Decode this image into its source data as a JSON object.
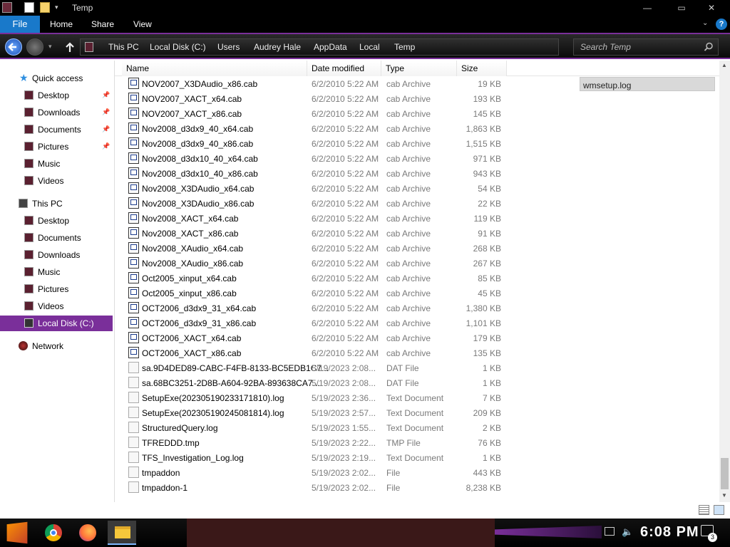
{
  "window": {
    "title": "Temp"
  },
  "title_buttons": {
    "minimize": "—",
    "maximize": "▭",
    "close": "✕"
  },
  "ribbon": {
    "file": "File",
    "tabs": [
      "Home",
      "Share",
      "View"
    ],
    "help": "?"
  },
  "nav": {
    "crumbs": [
      "This PC",
      "Local Disk (C:)",
      "Users",
      "Audrey Hale",
      "AppData",
      "Local",
      "Temp"
    ],
    "search_placeholder": "Search Temp"
  },
  "sidebar": {
    "quick_access": "Quick access",
    "qa_items": [
      "Desktop",
      "Downloads",
      "Documents",
      "Pictures",
      "Music",
      "Videos"
    ],
    "this_pc": "This PC",
    "pc_items": [
      "Desktop",
      "Documents",
      "Downloads",
      "Music",
      "Pictures",
      "Videos"
    ],
    "local_disk": "Local Disk (C:)",
    "network": "Network"
  },
  "columns": {
    "name": "Name",
    "date": "Date modified",
    "type": "Type",
    "size": "Size"
  },
  "files": [
    {
      "name": "NOV2007_X3DAudio_x86.cab",
      "date": "6/2/2010 5:22 AM",
      "type": "cab Archive",
      "size": "19 KB",
      "kind": "cab"
    },
    {
      "name": "NOV2007_XACT_x64.cab",
      "date": "6/2/2010 5:22 AM",
      "type": "cab Archive",
      "size": "193 KB",
      "kind": "cab"
    },
    {
      "name": "NOV2007_XACT_x86.cab",
      "date": "6/2/2010 5:22 AM",
      "type": "cab Archive",
      "size": "145 KB",
      "kind": "cab"
    },
    {
      "name": "Nov2008_d3dx9_40_x64.cab",
      "date": "6/2/2010 5:22 AM",
      "type": "cab Archive",
      "size": "1,863 KB",
      "kind": "cab"
    },
    {
      "name": "Nov2008_d3dx9_40_x86.cab",
      "date": "6/2/2010 5:22 AM",
      "type": "cab Archive",
      "size": "1,515 KB",
      "kind": "cab"
    },
    {
      "name": "Nov2008_d3dx10_40_x64.cab",
      "date": "6/2/2010 5:22 AM",
      "type": "cab Archive",
      "size": "971 KB",
      "kind": "cab"
    },
    {
      "name": "Nov2008_d3dx10_40_x86.cab",
      "date": "6/2/2010 5:22 AM",
      "type": "cab Archive",
      "size": "943 KB",
      "kind": "cab"
    },
    {
      "name": "Nov2008_X3DAudio_x64.cab",
      "date": "6/2/2010 5:22 AM",
      "type": "cab Archive",
      "size": "54 KB",
      "kind": "cab"
    },
    {
      "name": "Nov2008_X3DAudio_x86.cab",
      "date": "6/2/2010 5:22 AM",
      "type": "cab Archive",
      "size": "22 KB",
      "kind": "cab"
    },
    {
      "name": "Nov2008_XACT_x64.cab",
      "date": "6/2/2010 5:22 AM",
      "type": "cab Archive",
      "size": "119 KB",
      "kind": "cab"
    },
    {
      "name": "Nov2008_XACT_x86.cab",
      "date": "6/2/2010 5:22 AM",
      "type": "cab Archive",
      "size": "91 KB",
      "kind": "cab"
    },
    {
      "name": "Nov2008_XAudio_x64.cab",
      "date": "6/2/2010 5:22 AM",
      "type": "cab Archive",
      "size": "268 KB",
      "kind": "cab"
    },
    {
      "name": "Nov2008_XAudio_x86.cab",
      "date": "6/2/2010 5:22 AM",
      "type": "cab Archive",
      "size": "267 KB",
      "kind": "cab"
    },
    {
      "name": "Oct2005_xinput_x64.cab",
      "date": "6/2/2010 5:22 AM",
      "type": "cab Archive",
      "size": "85 KB",
      "kind": "cab"
    },
    {
      "name": "Oct2005_xinput_x86.cab",
      "date": "6/2/2010 5:22 AM",
      "type": "cab Archive",
      "size": "45 KB",
      "kind": "cab"
    },
    {
      "name": "OCT2006_d3dx9_31_x64.cab",
      "date": "6/2/2010 5:22 AM",
      "type": "cab Archive",
      "size": "1,380 KB",
      "kind": "cab"
    },
    {
      "name": "OCT2006_d3dx9_31_x86.cab",
      "date": "6/2/2010 5:22 AM",
      "type": "cab Archive",
      "size": "1,101 KB",
      "kind": "cab"
    },
    {
      "name": "OCT2006_XACT_x64.cab",
      "date": "6/2/2010 5:22 AM",
      "type": "cab Archive",
      "size": "179 KB",
      "kind": "cab"
    },
    {
      "name": "OCT2006_XACT_x86.cab",
      "date": "6/2/2010 5:22 AM",
      "type": "cab Archive",
      "size": "135 KB",
      "kind": "cab"
    },
    {
      "name": "sa.9D4DED89-CABC-F4FB-8133-BC5EDB1C7...",
      "date": "5/19/2023 2:08...",
      "type": "DAT File",
      "size": "1 KB",
      "kind": "doc"
    },
    {
      "name": "sa.68BC3251-2D8B-A604-92BA-893638CA7...",
      "date": "5/19/2023 2:08...",
      "type": "DAT File",
      "size": "1 KB",
      "kind": "doc"
    },
    {
      "name": "SetupExe(202305190233171810).log",
      "date": "5/19/2023 2:36...",
      "type": "Text Document",
      "size": "7 KB",
      "kind": "doc"
    },
    {
      "name": "SetupExe(202305190245081814).log",
      "date": "5/19/2023 2:57...",
      "type": "Text Document",
      "size": "209 KB",
      "kind": "doc"
    },
    {
      "name": "StructuredQuery.log",
      "date": "5/19/2023 1:55...",
      "type": "Text Document",
      "size": "2 KB",
      "kind": "doc"
    },
    {
      "name": "TFREDDD.tmp",
      "date": "5/19/2023 2:22...",
      "type": "TMP File",
      "size": "76 KB",
      "kind": "doc"
    },
    {
      "name": "TFS_Investigation_Log.log",
      "date": "5/19/2023 2:19...",
      "type": "Text Document",
      "size": "1 KB",
      "kind": "doc"
    },
    {
      "name": "tmpaddon",
      "date": "5/19/2023 2:02...",
      "type": "File",
      "size": "443 KB",
      "kind": "doc"
    },
    {
      "name": "tmpaddon-1",
      "date": "5/19/2023 2:02...",
      "type": "File",
      "size": "8,238 KB",
      "kind": "doc"
    }
  ],
  "preview": {
    "selected_name": "wmsetup.log"
  },
  "taskbar": {
    "clock": "6:08 PM",
    "notification_count": "3"
  },
  "colors": {
    "accent": "#7a2f9a",
    "file_tab": "#1979ca",
    "secondary_text": "#7a7a7a"
  },
  "icons": [
    "back-icon",
    "forward-icon",
    "up-icon",
    "search-icon",
    "quick-access-star-icon",
    "pin-icon",
    "cab-file-icon",
    "document-icon",
    "network-icon",
    "chrome-icon",
    "firefox-icon",
    "file-explorer-icon"
  ]
}
